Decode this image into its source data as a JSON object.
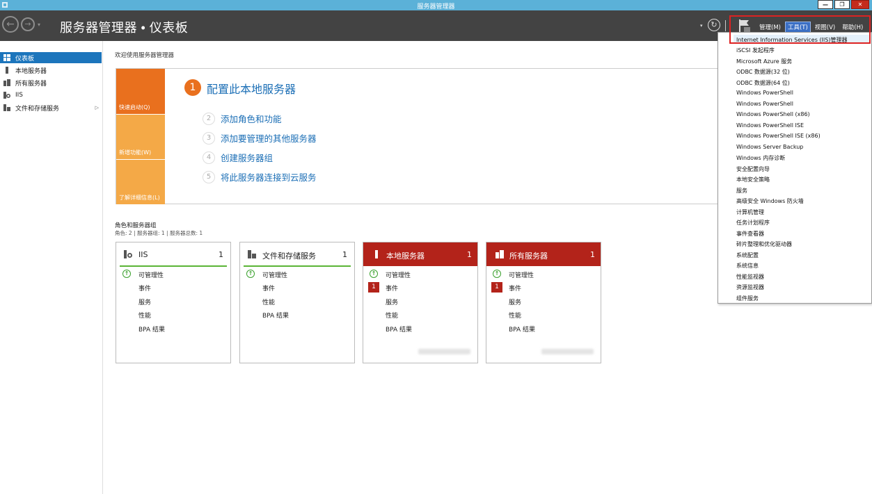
{
  "window": {
    "title": "服务器管理器",
    "buttons": [
      "—",
      "❐",
      "✕"
    ]
  },
  "header": {
    "breadcrumb": "服务器管理器 • 仪表板",
    "menus": [
      {
        "label": "管理(M)",
        "active": false
      },
      {
        "label": "工具(T)",
        "active": true
      },
      {
        "label": "视图(V)",
        "active": false
      },
      {
        "label": "帮助(H)",
        "active": false
      }
    ]
  },
  "sidebar": {
    "items": [
      {
        "label": "仪表板",
        "icon": "dashboard-icon",
        "active": true
      },
      {
        "label": "本地服务器",
        "icon": "server-icon",
        "active": false
      },
      {
        "label": "所有服务器",
        "icon": "servers-icon",
        "active": false
      },
      {
        "label": "IIS",
        "icon": "iis-icon",
        "active": false
      },
      {
        "label": "文件和存储服务",
        "icon": "storage-icon",
        "active": false,
        "expandable": true
      }
    ]
  },
  "main": {
    "welcome": "欢迎使用服务器管理器",
    "quick_tabs": [
      "快速启动(Q)",
      "新增功能(W)",
      "了解详细信息(L)"
    ],
    "step1": {
      "num": "1",
      "label": "配置此本地服务器"
    },
    "steps": [
      {
        "num": "2",
        "label": "添加角色和功能"
      },
      {
        "num": "3",
        "label": "添加要管理的其他服务器"
      },
      {
        "num": "4",
        "label": "创建服务器组"
      },
      {
        "num": "5",
        "label": "将此服务器连接到云服务"
      }
    ],
    "roles_title": "角色和服务器组",
    "roles_sub": "角色: 2 | 服务器组: 1 | 服务器总数: 1",
    "tiles": [
      {
        "name": "IIS",
        "count": "1",
        "red": false,
        "rows": [
          "可管理性",
          "事件",
          "服务",
          "性能",
          "BPA 结果"
        ],
        "event_badge": ""
      },
      {
        "name": "文件和存储服务",
        "count": "1",
        "red": false,
        "rows": [
          "可管理性",
          "事件",
          "性能",
          "BPA 结果"
        ],
        "event_badge": ""
      },
      {
        "name": "本地服务器",
        "count": "1",
        "red": true,
        "rows": [
          "可管理性",
          "事件",
          "服务",
          "性能",
          "BPA 结果"
        ],
        "event_badge": "1"
      },
      {
        "name": "所有服务器",
        "count": "1",
        "red": true,
        "rows": [
          "可管理性",
          "事件",
          "服务",
          "性能",
          "BPA 结果"
        ],
        "event_badge": "1"
      }
    ]
  },
  "tools_menu": {
    "items": [
      "Internet Information Services (IIS)管理器",
      "iSCSI 发起程序",
      "Microsoft Azure 服务",
      "ODBC 数据源(32 位)",
      "ODBC 数据源(64 位)",
      "Windows PowerShell",
      "Windows PowerShell",
      "Windows PowerShell (x86)",
      "Windows PowerShell ISE",
      "Windows PowerShell ISE (x86)",
      "Windows Server Backup",
      "Windows 内存诊断",
      "安全配置向导",
      "本地安全策略",
      "服务",
      "高级安全 Windows 防火墙",
      "计算机管理",
      "任务计划程序",
      "事件查看器",
      "碎片整理和优化驱动器",
      "系统配置",
      "系统信息",
      "性能监视器",
      "资源监视器",
      "组件服务"
    ]
  },
  "colors": {
    "accent": "#1c75bc",
    "orange": "#e9701e",
    "light_orange": "#f4a947",
    "red_tile": "#b3231a",
    "header_bg": "#434343",
    "highlight_box": "#dd2222"
  }
}
